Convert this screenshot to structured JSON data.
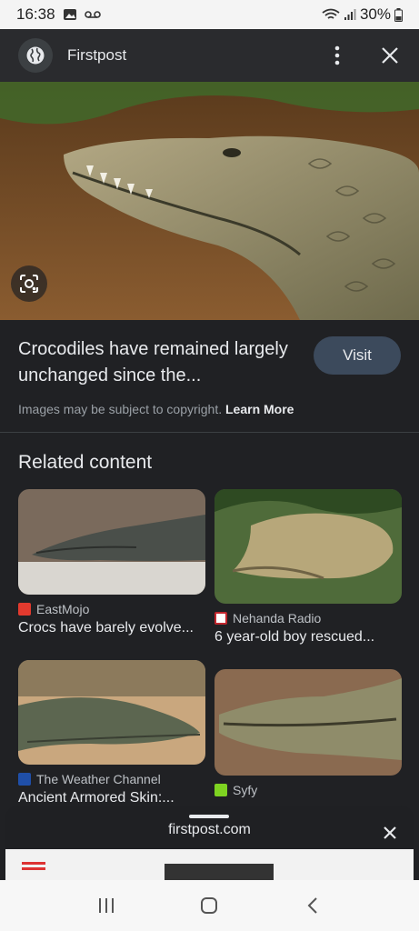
{
  "status_bar": {
    "time": "16:38",
    "battery": "30%"
  },
  "header": {
    "site_name": "Firstpost"
  },
  "result": {
    "title": "Crocodiles have remained largely unchanged since the...",
    "visit_label": "Visit",
    "copyright_text": "Images may be subject to copyright.",
    "learn_more": "Learn More"
  },
  "related": {
    "heading": "Related content",
    "items": [
      {
        "source": "EastMojo",
        "caption": "Crocs have barely evolve..."
      },
      {
        "source": "Nehanda Radio",
        "caption": "6 year-old boy rescued..."
      },
      {
        "source": "The Weather Channel",
        "caption": "Ancient Armored Skin:..."
      },
      {
        "source": "Syfy",
        "caption": ""
      }
    ]
  },
  "sheet": {
    "url": "firstpost.com"
  },
  "icons": {
    "globe": "globe-icon",
    "more": "more-vert-icon",
    "close": "close-icon",
    "lens": "lens-icon",
    "recents": "recents-icon",
    "home": "home-icon",
    "back": "back-icon"
  },
  "colors": {
    "background": "#202124",
    "visit_button": "#3c4a5c",
    "text": "#e8eaed",
    "muted": "#9aa0a6"
  }
}
